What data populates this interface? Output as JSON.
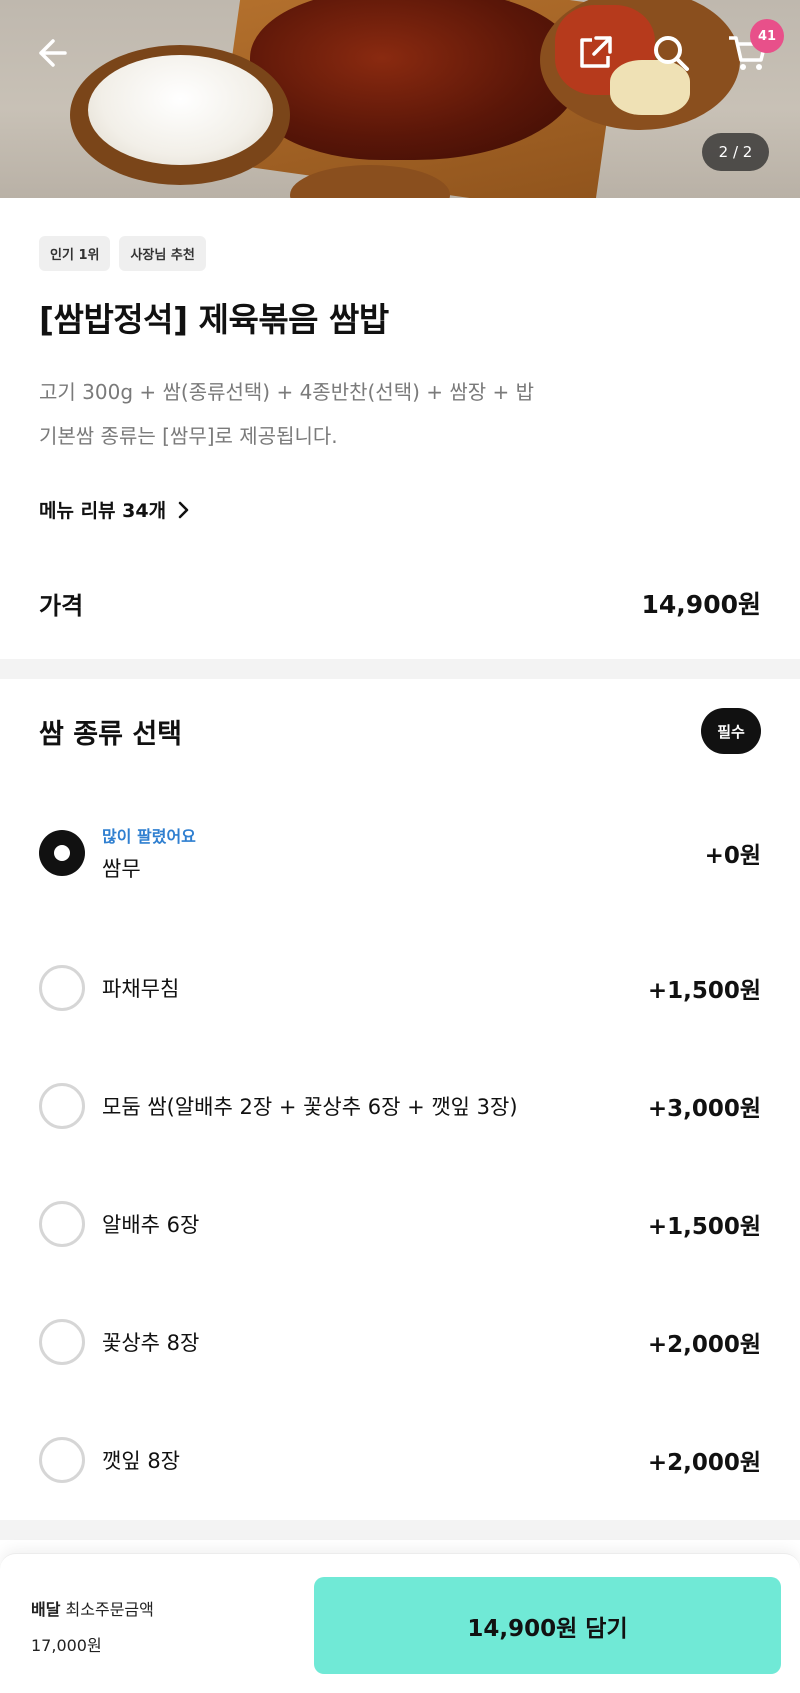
{
  "header": {
    "cart_count": "41",
    "image_pager": "2 / 2"
  },
  "menu": {
    "tags": [
      "인기 1위",
      "사장님 추천"
    ],
    "title": "[쌈밥정석] 제육볶음 쌈밥",
    "desc_line1": "고기 300g + 쌈(종류선택) + 4종반찬(선택) + 쌈장 + 밥",
    "desc_line2": "기본쌈 종류는 [쌈무]로 제공됩니다.",
    "review_link": "메뉴 리뷰 34개",
    "price_label": "가격",
    "price_value": "14,900원"
  },
  "options": {
    "title": "쌈 종류 선택",
    "required_label": "필수",
    "items": [
      {
        "badge": "많이 팔렸어요",
        "label": "쌈무",
        "price": "+0원",
        "selected": true
      },
      {
        "label": "파채무침",
        "price": "+1,500원"
      },
      {
        "label": "모둠 쌈(알배추 2장 + 꽃상추 6장 + 깻잎 3장)",
        "price": "+3,000원"
      },
      {
        "label": "알배추 6장",
        "price": "+1,500원"
      },
      {
        "label": "꽃상추 8장",
        "price": "+2,000원"
      },
      {
        "label": "깻잎 8장",
        "price": "+2,000원"
      }
    ]
  },
  "bottom_bar": {
    "delivery_label": "배달",
    "min_order_label": "최소주문금액",
    "min_order_value": "17,000원",
    "add_button": "14,900원 담기"
  },
  "colors": {
    "accent": "#70e9d6",
    "badge_pink": "#e8508a",
    "popular_blue": "#2f7fd0"
  },
  "icons": [
    "back-arrow-icon",
    "share-icon",
    "search-icon",
    "cart-icon",
    "chevron-right-icon"
  ]
}
